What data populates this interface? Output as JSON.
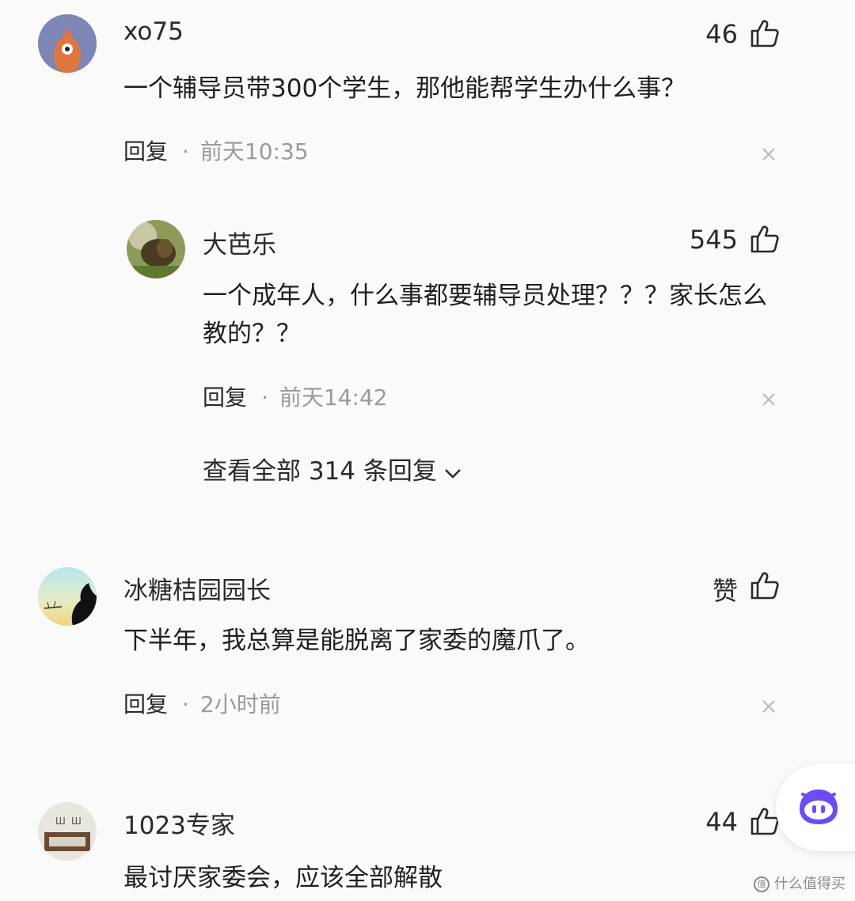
{
  "comments": [
    {
      "username": "xo75",
      "likes": "46",
      "content": "一个辅导员带300个学生，那他能帮学生办什么事？",
      "reply_label": "回复",
      "dot": "·",
      "time": "前天10:35"
    },
    {
      "username": "冰糖桔园园长",
      "likes": "赞",
      "content": "下半年，我总算是能脱离了家委的魔爪了。",
      "reply_label": "回复",
      "dot": "·",
      "time": "2小时前"
    },
    {
      "username": "1023专家",
      "likes": "44",
      "content": "最讨厌家委会，应该全部解散"
    }
  ],
  "reply": {
    "username": "大芭乐",
    "likes": "545",
    "content": "一个成年人，什么事都要辅导员处理？？？家长怎么教的？？",
    "reply_label": "回复",
    "dot": "·",
    "time": "前天14:42"
  },
  "view_all": "查看全部 314 条回复",
  "watermark": "什么值得买",
  "icons": {
    "like": "thumbs-up-icon",
    "close": "close-icon",
    "expand": "chevron-down-icon",
    "assistant": "bot-icon"
  },
  "colors": {
    "background": "#fafafa",
    "muted_text": "#9a9a9a",
    "bot_accent": "#6c4cf5"
  }
}
